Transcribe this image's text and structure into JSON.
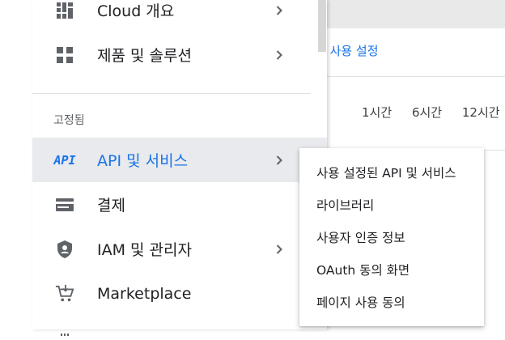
{
  "background": {
    "link_text": "스 사용 설정",
    "time_tabs": [
      "1시간",
      "6시간",
      "12시간"
    ]
  },
  "drawer": {
    "items_top": [
      {
        "label": "Cloud 개요",
        "icon": "dashboard-icon",
        "has_submenu": true
      },
      {
        "label": "제품 및 솔루션",
        "icon": "grid-icon",
        "has_submenu": true
      }
    ],
    "pinned_label": "고정됨",
    "pinned_items": [
      {
        "label": "API 및 서비스",
        "icon": "api-icon",
        "icon_text": "API",
        "has_submenu": true,
        "active": true
      },
      {
        "label": "결제",
        "icon": "billing-icon",
        "has_submenu": false
      },
      {
        "label": "IAM 및 관리자",
        "icon": "shield-icon",
        "has_submenu": true
      },
      {
        "label": "Marketplace",
        "icon": "cart-icon",
        "has_submenu": false
      }
    ]
  },
  "submenu": {
    "items": [
      "사용 설정된 API 및 서비스",
      "라이브러리",
      "사용자 인증 정보",
      "OAuth 동의 화면",
      "페이지 사용 동의"
    ]
  },
  "colors": {
    "accent": "#1a73e8",
    "active_bg": "#e8eaed",
    "icon_gray": "#5f6368"
  }
}
